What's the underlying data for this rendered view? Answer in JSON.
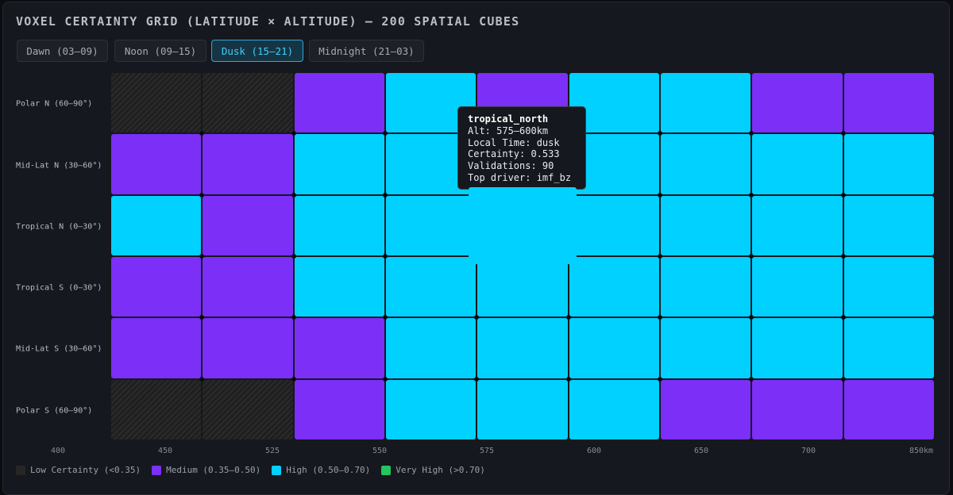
{
  "title": "VOXEL CERTAINTY GRID (LATITUDE × ALTITUDE) — 200 SPATIAL CUBES",
  "tabs": [
    {
      "label": "Dawn (03–09)",
      "active": false
    },
    {
      "label": "Noon (09–15)",
      "active": false
    },
    {
      "label": "Dusk (15–21)",
      "active": true
    },
    {
      "label": "Midnight (21–03)",
      "active": false
    }
  ],
  "rows": [
    "Polar N (60–90°)",
    "Mid-Lat N (30–60°)",
    "Tropical N (0–30°)",
    "Tropical S (0–30°)",
    "Mid-Lat S (30–60°)",
    "Polar S (60–90°)"
  ],
  "x_ticks": [
    "400",
    "450",
    "525",
    "550",
    "575",
    "600",
    "650",
    "700",
    "850km"
  ],
  "grid": [
    [
      "low",
      "low",
      "medium",
      "high",
      "medium",
      "high",
      "high",
      "medium",
      "medium"
    ],
    [
      "medium",
      "medium",
      "high",
      "high",
      "high",
      "high",
      "high",
      "high",
      "high"
    ],
    [
      "high",
      "medium",
      "high",
      "high",
      "high",
      "high",
      "high",
      "high",
      "high"
    ],
    [
      "medium",
      "medium",
      "high",
      "high",
      "high",
      "high",
      "high",
      "high",
      "high"
    ],
    [
      "medium",
      "medium",
      "medium",
      "high",
      "high",
      "high",
      "high",
      "high",
      "high"
    ],
    [
      "low",
      "low",
      "medium",
      "high",
      "high",
      "high",
      "medium",
      "medium",
      "medium"
    ]
  ],
  "hover_cell": {
    "row": 2,
    "col": 4
  },
  "colors": {
    "low": "#262626",
    "medium": "#7b2ff7",
    "high": "#00d1ff",
    "very_high": "#22c55e"
  },
  "legend": [
    {
      "key": "low",
      "label": "Low Certainty (<0.35)"
    },
    {
      "key": "medium",
      "label": "Medium (0.35–0.50)"
    },
    {
      "key": "high",
      "label": "High (0.50–0.70)"
    },
    {
      "key": "very_high",
      "label": "Very High (>0.70)"
    }
  ],
  "tooltip": {
    "title": "tropical_north",
    "alt": "Alt: 575–600km",
    "local_time": "Local Time: dusk",
    "certainty": "Certainty: 0.533",
    "validations": "Validations: 90",
    "top_driver": "Top driver: imf_bz"
  }
}
